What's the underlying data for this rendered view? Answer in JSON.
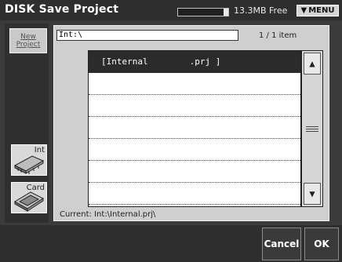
{
  "title": "DISK Save Project",
  "storage": {
    "free_text": "13.3MB Free",
    "used_fraction": 0.9
  },
  "menu_label": "MENU",
  "new_project_label": "New Project",
  "media": [
    {
      "label": "Int"
    },
    {
      "label": "Card"
    }
  ],
  "path": "Int:\\",
  "item_count": "1 / 1 item",
  "files": [
    {
      "text": "[Internal        .prj ]",
      "selected": true
    },
    {
      "text": "",
      "selected": false
    },
    {
      "text": "",
      "selected": false
    },
    {
      "text": "",
      "selected": false
    },
    {
      "text": "",
      "selected": false
    },
    {
      "text": "",
      "selected": false
    },
    {
      "text": "",
      "selected": false
    }
  ],
  "current_path": "Current: Int:\\Internal.prj\\",
  "buttons": {
    "cancel": "Cancel",
    "ok": "OK"
  },
  "colors": {
    "background": "#3b3b3b",
    "panel": "#cfcfcf",
    "selection": "#2b2b2b"
  }
}
